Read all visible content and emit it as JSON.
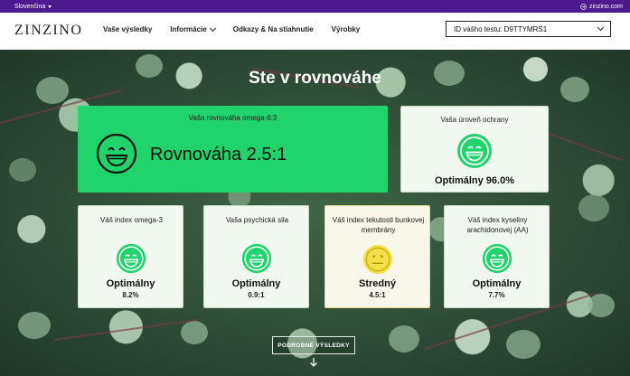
{
  "topbar": {
    "language": "Slovenčina",
    "site": "zinzino.com"
  },
  "header": {
    "logo": "ZINZINO",
    "nav": [
      {
        "label": "Vaše výsledky"
      },
      {
        "label": "Informácie"
      },
      {
        "label": "Odkazy & Na stiahnutie"
      },
      {
        "label": "Výrobky"
      }
    ],
    "test_id": "ID vášho testu: D9TTYMRS1"
  },
  "main": {
    "title": "Ste v rovnováhe",
    "balance": {
      "label": "Vaša rovnováha omega-6:3",
      "value": "Rovnováha 2.5:1",
      "icon": "happy-face-icon"
    },
    "protection": {
      "label": "Vaša úroveň ochrany",
      "status": "Optimálny 96.0%",
      "icon": "happy-face-icon"
    },
    "cards": [
      {
        "label": "Váš index omega-3",
        "status": "Optimálny",
        "value": "8.2%",
        "icon": "happy-face-icon",
        "color": "#20d36a"
      },
      {
        "label": "Vaša psychická sila",
        "status": "Optimálny",
        "value": "0.9:1",
        "icon": "happy-face-icon",
        "color": "#20d36a"
      },
      {
        "label": "Váš index tekutosti bunkovej membrány",
        "status": "Stredný",
        "value": "4.5:1",
        "icon": "neutral-face-icon",
        "color": "#f4e04a"
      },
      {
        "label": "Váš index kyseliny arachidonovej (AA)",
        "status": "Optimálny",
        "value": "7.7%",
        "icon": "happy-face-icon",
        "color": "#20d36a"
      }
    ],
    "details_button": "PODROBNÉ VÝSLEDKY"
  },
  "colors": {
    "topbar": "#4b1a8c",
    "accent_green": "#20d36a",
    "neutral_yellow": "#f4e04a"
  }
}
